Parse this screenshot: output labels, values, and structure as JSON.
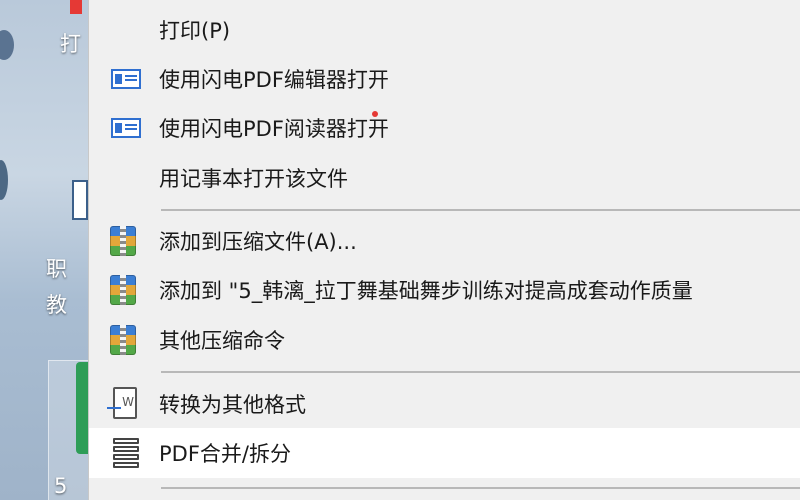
{
  "desktop": {
    "labels": [
      "打",
      "职",
      "教",
      "5"
    ]
  },
  "menu": {
    "items": [
      {
        "label": "打印(P)",
        "icon": "none"
      },
      {
        "label": "使用闪电PDF编辑器打开",
        "icon": "pdf-editor-icon"
      },
      {
        "label": "使用闪电PDF阅读器打开",
        "icon": "pdf-reader-icon"
      },
      {
        "label": "用记事本打开该文件",
        "icon": "none"
      },
      {
        "label": "添加到压缩文件(A)...",
        "icon": "archive-icon"
      },
      {
        "label": "添加到 \"5_韩漓_拉丁舞基础舞步训练对提高成套动作质量",
        "icon": "archive-icon"
      },
      {
        "label": "其他压缩命令",
        "icon": "archive-icon"
      },
      {
        "label": "转换为其他格式",
        "icon": "convert-format-icon"
      },
      {
        "label": "PDF合并/拆分",
        "icon": "pdf-merge-split-icon"
      }
    ]
  },
  "colors": {
    "menu_bg": "#f0f0f0",
    "hover_bg": "#ffffff",
    "separator": "#b8b8b8",
    "accent_blue": "#2f6fd0"
  }
}
